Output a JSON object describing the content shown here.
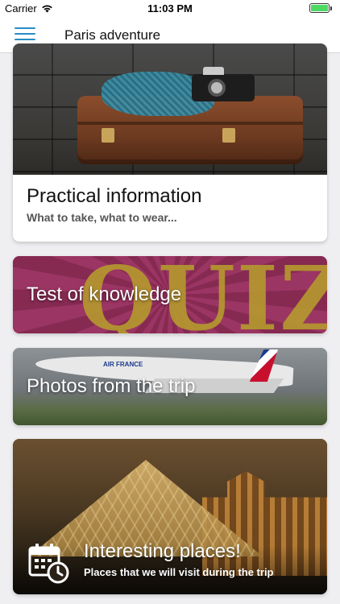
{
  "status_bar": {
    "carrier": "Carrier",
    "time": "11:03 PM"
  },
  "nav": {
    "title": "Paris adventure",
    "menu_icon": "hamburger-menu-icon"
  },
  "cards": {
    "practical": {
      "title": "Practical information",
      "subtitle": "What to take, what to wear..."
    },
    "quiz": {
      "title": "Test of knowledge",
      "image_text": "QUIZ"
    },
    "photos": {
      "title": "Photos from the trip",
      "image_text": "AIR FRANCE"
    },
    "places": {
      "title": "Interesting places!",
      "subtitle": "Places that we will visit during the trip",
      "icon": "calendar-clock-icon"
    }
  },
  "colors": {
    "accent": "#2a8cc4",
    "battery": "#4cd964",
    "background": "#efeff2"
  }
}
